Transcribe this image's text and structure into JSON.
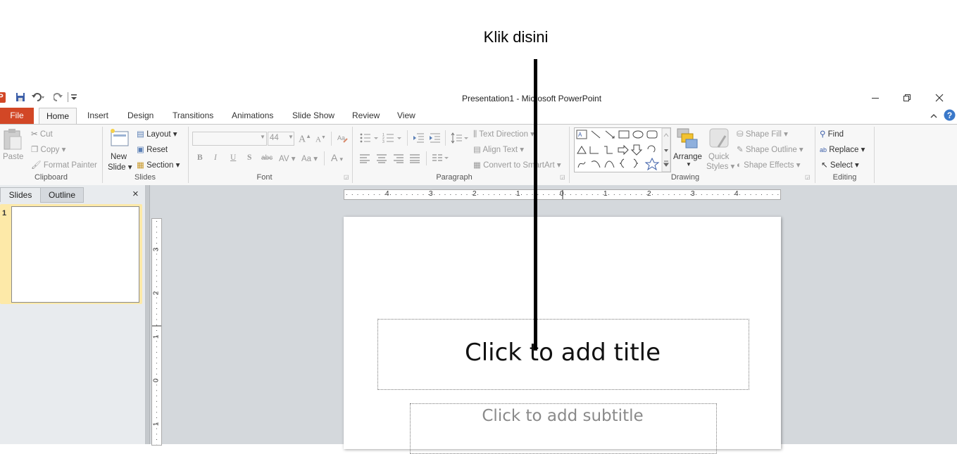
{
  "annotation": {
    "label": "Klik disini"
  },
  "app": {
    "title": "Presentation1  -  Microsoft PowerPoint",
    "icon_letter": "P"
  },
  "ribbon_tabs": {
    "file": "File",
    "home": "Home",
    "insert": "Insert",
    "design": "Design",
    "transitions": "Transitions",
    "animations": "Animations",
    "slide_show": "Slide Show",
    "review": "Review",
    "view": "View"
  },
  "clipboard": {
    "paste": "Paste",
    "cut": "Cut",
    "copy": "Copy",
    "format_painter": "Format Painter",
    "group": "Clipboard"
  },
  "slides_group": {
    "new_slide_1": "New",
    "new_slide_2": "Slide",
    "layout": "Layout",
    "reset": "Reset",
    "section": "Section",
    "group": "Slides"
  },
  "font": {
    "font_size": "44",
    "bold": "B",
    "italic": "I",
    "underline": "U",
    "shadow": "S",
    "strike": "abc",
    "spacing": "AV",
    "case": "Aa",
    "color": "A",
    "grow": "A",
    "shrink": "A",
    "group": "Font"
  },
  "paragraph": {
    "text_direction": "Text Direction",
    "align_text": "Align Text",
    "smartart": "Convert to SmartArt",
    "group": "Paragraph"
  },
  "drawing": {
    "arrange": "Arrange",
    "quick_styles_1": "Quick",
    "quick_styles_2": "Styles",
    "shape_fill": "Shape Fill",
    "shape_outline": "Shape Outline",
    "shape_effects": "Shape Effects",
    "group": "Drawing"
  },
  "editing": {
    "find": "Find",
    "replace": "Replace",
    "select": "Select",
    "group": "Editing"
  },
  "pane": {
    "tab_slides": "Slides",
    "tab_outline": "Outline",
    "close": "×",
    "slide_number": "1"
  },
  "ruler": {
    "h_ticks": [
      "4",
      "3",
      "2",
      "1",
      "0",
      "1",
      "2",
      "3",
      "4"
    ],
    "v_ticks": [
      "3",
      "2",
      "1",
      "0",
      "1"
    ]
  },
  "slide": {
    "title_placeholder": "Click to add title",
    "subtitle_placeholder": "Click to add subtitle"
  },
  "colors": {
    "file_tab": "#d24726",
    "ribbon_bg": "#f7f7f7",
    "workspace_bg": "#d4d8dc",
    "thumb_highlight": "#fde9a8"
  }
}
